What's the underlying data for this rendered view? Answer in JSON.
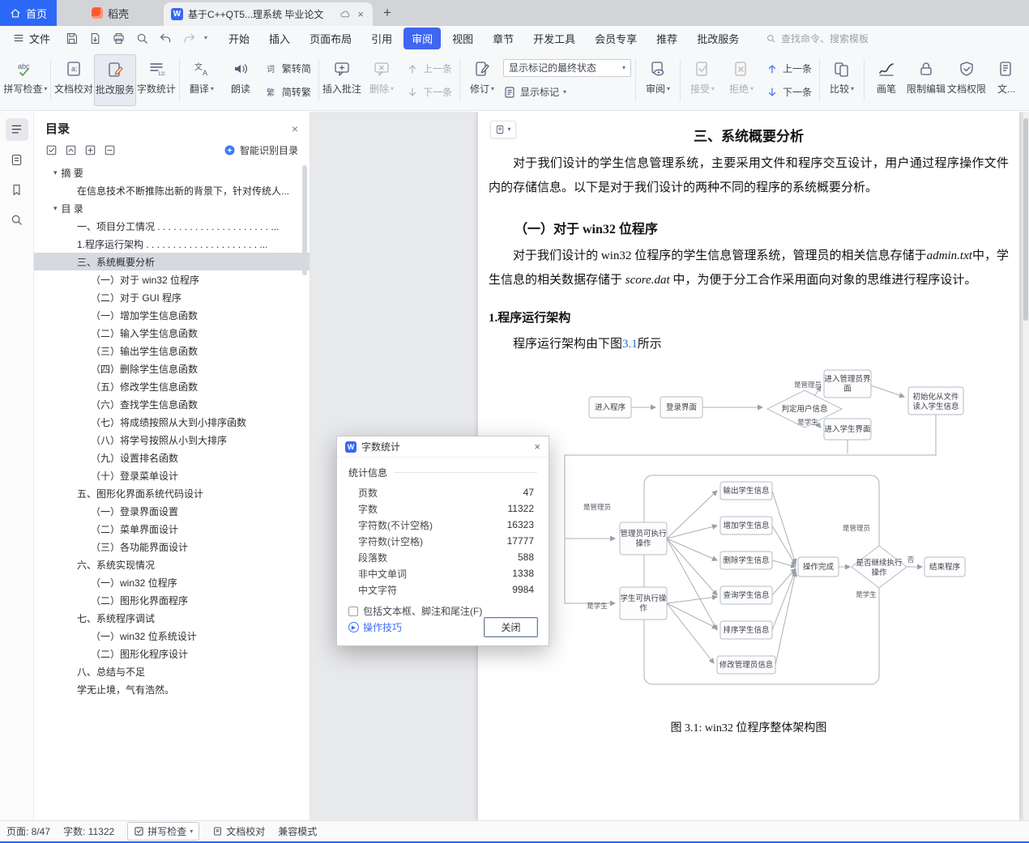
{
  "icons": {
    "caret_down": "▾",
    "close": "×",
    "plus": "+",
    "minus": "−",
    "new_tab": "+",
    "tips_play": "▶",
    "logo_w": "W",
    "expand_caret": "▾"
  },
  "tabbar": {
    "home": "首页",
    "docer": "稻壳",
    "document": "基于C++QT5...理系统 毕业论文"
  },
  "menubar": {
    "file": "文件",
    "search": "查找命令、搜索模板",
    "tabs": [
      {
        "label": "开始",
        "cls": ""
      },
      {
        "label": "插入",
        "cls": ""
      },
      {
        "label": "页面布局",
        "cls": ""
      },
      {
        "label": "引用",
        "cls": ""
      },
      {
        "label": "审阅",
        "cls": "active"
      },
      {
        "label": "视图",
        "cls": ""
      },
      {
        "label": "章节",
        "cls": ""
      },
      {
        "label": "开发工具",
        "cls": ""
      },
      {
        "label": "会员专享",
        "cls": ""
      },
      {
        "label": "推荐",
        "cls": ""
      },
      {
        "label": "批改服务",
        "cls": ""
      }
    ]
  },
  "ribbon": {
    "spell": "拼写检查",
    "proof": "文档校对",
    "grade": "批改服务",
    "wordcount": "字数统计",
    "translate": "翻译",
    "read": "朗读",
    "t2s": "繁转简",
    "s2t": "简转繁",
    "insert_comment": "插入批注",
    "del": "删除",
    "prev1": "上一条",
    "next1": "下一条",
    "revision": "修订",
    "markup_state": "显示标记的最终状态",
    "show_markup": "显示标记",
    "review": "审阅",
    "accept": "接受",
    "reject": "拒绝",
    "prev2": "上一条",
    "next2": "下一条",
    "compare": "比较",
    "pen": "画笔",
    "restrict": "限制编辑",
    "perm": "文档权限",
    "overflow": "文..."
  },
  "sidebar": {
    "title": "目录",
    "smart_label": "智能识别目录",
    "items": [
      {
        "label": "摘 要",
        "cls": "lv0"
      },
      {
        "label": "在信息技术不断推陈出新的背景下，针对传统人...",
        "cls": "lv1"
      },
      {
        "label": "目 录",
        "cls": "lv0"
      },
      {
        "label": "一、项目分工情况 . . . . . . . . . . . . . . . . . . . . . ...",
        "cls": "lv1"
      },
      {
        "label": "1.程序运行架构 . . . . . . . . . . . . . . . . . . . . .  ...",
        "cls": "lv1"
      },
      {
        "label": "三、系统概要分析",
        "cls": "lv1 sel"
      },
      {
        "label": "（一）对于 win32 位程序",
        "cls": "lv2"
      },
      {
        "label": "（二）对于 GUI 程序",
        "cls": "lv2"
      },
      {
        "label": "（一）增加学生信息函数",
        "cls": "lv2"
      },
      {
        "label": "（二）输入学生信息函数",
        "cls": "lv2"
      },
      {
        "label": "（三）输出学生信息函数",
        "cls": "lv2"
      },
      {
        "label": "（四）删除学生信息函数",
        "cls": "lv2"
      },
      {
        "label": "（五）修改学生信息函数",
        "cls": "lv2"
      },
      {
        "label": "（六）查找学生信息函数",
        "cls": "lv2"
      },
      {
        "label": "（七）将成绩按照从大到小排序函数",
        "cls": "lv2"
      },
      {
        "label": "（八）将学号按照从小到大排序",
        "cls": "lv2"
      },
      {
        "label": "（九）设置排名函数",
        "cls": "lv2"
      },
      {
        "label": "（十）登录菜单设计",
        "cls": "lv2"
      },
      {
        "label": "五、图形化界面系统代码设计",
        "cls": "lv1"
      },
      {
        "label": "（一）登录界面设置",
        "cls": "lv2"
      },
      {
        "label": "（二）菜单界面设计",
        "cls": "lv2"
      },
      {
        "label": "（三）各功能界面设计",
        "cls": "lv2"
      },
      {
        "label": "六、系统实现情况",
        "cls": "lv1"
      },
      {
        "label": "（一）win32 位程序",
        "cls": "lv2"
      },
      {
        "label": "（二）图形化界面程序",
        "cls": "lv2"
      },
      {
        "label": "七、系统程序调试",
        "cls": "lv1"
      },
      {
        "label": "（一）win32 位系统设计",
        "cls": "lv2"
      },
      {
        "label": "（二）图形化程序设计",
        "cls": "lv2"
      },
      {
        "label": "八、总结与不足",
        "cls": "lv1"
      },
      {
        "label": "学无止境，气有浩然。",
        "cls": "lv1"
      }
    ]
  },
  "document": {
    "heading": "三、系统概要分析",
    "para1": "对于我们设计的学生信息管理系统，主要采用文件和程序交互设计，用户通过程序操作文件内的存储信息。以下是对于我们设计的两种不同的程序的系统概要分析。",
    "sub1": "（一）对于 win32 位程序",
    "para2_a": "对于我们设计的 win32 位程序的学生信息管理系统，管理员的相关信息存储于",
    "para2_b": "admin.txt",
    "para2_c": "中，学生信息的相关数据存储于 ",
    "para2_d": "score.dat",
    "para2_e": " 中，为便于分工合作采用面向对象的思维进行程序设计。",
    "sub2": "1.程序运行架构",
    "para3_a": "程序运行架构由下图",
    "para3_link": "3.1",
    "para3_b": "所示",
    "caption": "图 3.1: win32 位程序整体架构图"
  },
  "flow": {
    "enter": "进入程序",
    "login": "登录界面",
    "judge": "判定用户信息",
    "admin_ui1": "进入管理员界",
    "admin_ui2": "面",
    "init1": "初始化从文件",
    "init2": "读入学生信息",
    "student_ui": "进入学生界面",
    "lbl_admin1": "是管理员",
    "lbl_student1": "是学生",
    "adminops1": "管理员可执行",
    "adminops2": "操作",
    "studentops1": "学生可执行操",
    "studentops2": "作",
    "lbl_admin2": "是管理员",
    "lbl_student2": "是学生",
    "lbl_admin3": "是管理员",
    "lbl_student3": "是学生",
    "op1": "输出学生信息",
    "op2": "增加学生信息",
    "op3": "删除学生信息",
    "op4": "查询学生信息",
    "op5": "排序学生信息",
    "op6": "修改管理员信息",
    "done": "操作完成",
    "cont1": "是否继续执行",
    "cont2": "操作",
    "lbl_no": "否",
    "end": "结束程序"
  },
  "dialog": {
    "title": "字数统计",
    "group_label": "统计信息",
    "rows": [
      {
        "label": "页数",
        "value": "47"
      },
      {
        "label": "字数",
        "value": "11322"
      },
      {
        "label": "字符数(不计空格)",
        "value": "16323"
      },
      {
        "label": "字符数(计空格)",
        "value": "17777"
      },
      {
        "label": "段落数",
        "value": "588"
      },
      {
        "label": "非中文单词",
        "value": "1338"
      },
      {
        "label": "中文字符",
        "value": "9984"
      }
    ],
    "checkbox_label": "包括文本框、脚注和尾注(F)",
    "tips_label": "操作技巧",
    "close_label": "关闭"
  },
  "statusbar": {
    "page": "页面: 8/47",
    "words": "字数: 11322",
    "spell": "拼写检查",
    "proof": "文档校对",
    "mode": "兼容模式"
  }
}
